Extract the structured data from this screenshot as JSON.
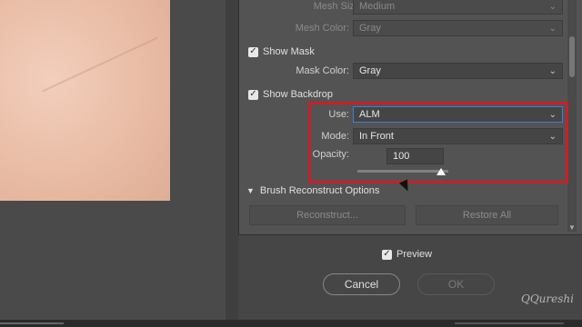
{
  "mesh": {
    "size_label": "Mesh Size:",
    "size_value": "Medium",
    "color_label": "Mesh Color:",
    "color_value": "Gray"
  },
  "show_mask": {
    "label": "Show Mask",
    "checked": true,
    "color_label": "Mask Color:",
    "color_value": "Gray"
  },
  "show_backdrop": {
    "label": "Show Backdrop",
    "checked": true,
    "use_label": "Use:",
    "use_value": "ALM",
    "mode_label": "Mode:",
    "mode_value": "In Front",
    "opacity_label": "Opacity:",
    "opacity_value": "100",
    "opacity_level": 0.92
  },
  "brush_reconstruct": {
    "header": "Brush Reconstruct Options",
    "reconstruct_label": "Reconstruct...",
    "restore_all_label": "Restore All"
  },
  "preview": {
    "label": "Preview",
    "checked": true
  },
  "buttons": {
    "cancel": "Cancel",
    "ok": "OK"
  },
  "watermark": "QQureshi",
  "colors": {
    "highlight": "#c8202a",
    "focus": "#3c7fd6"
  }
}
